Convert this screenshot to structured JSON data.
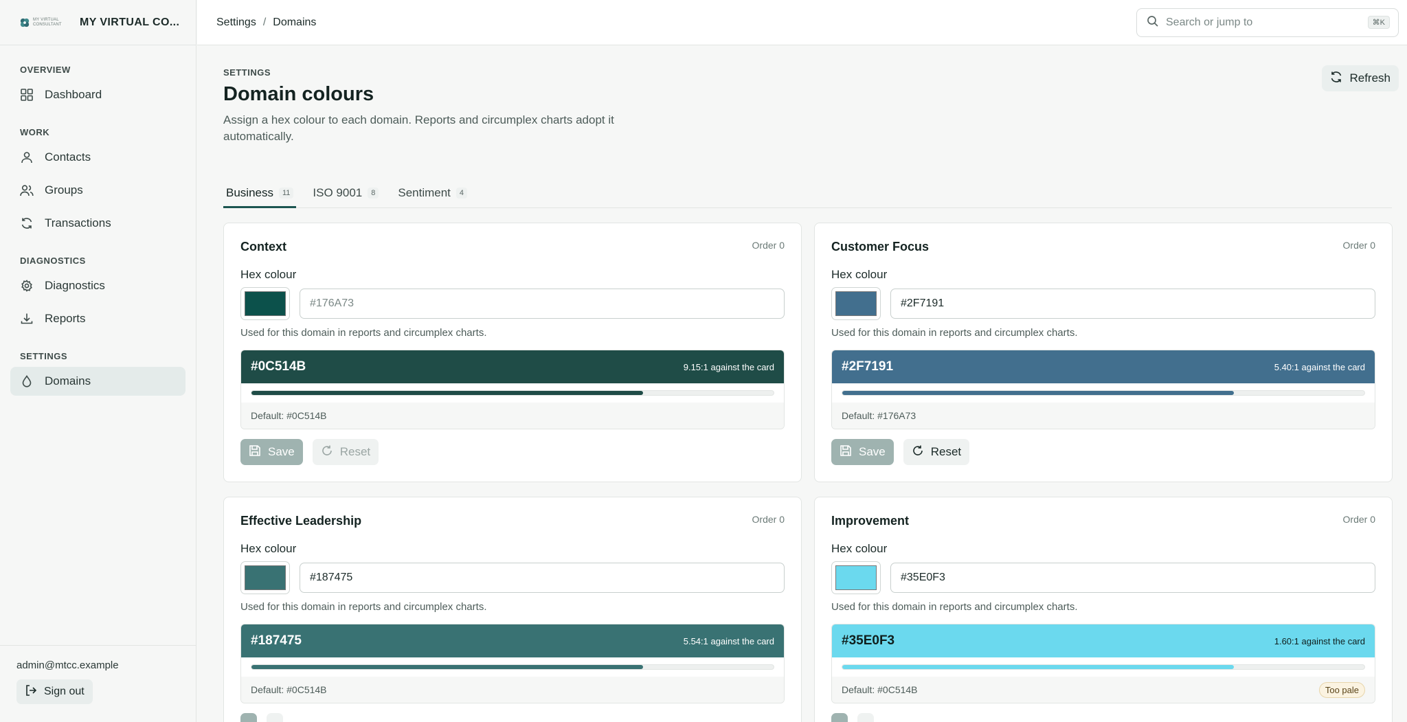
{
  "brand": {
    "small_text": "MY VIRTUAL CONSULTANT",
    "name": "MY VIRTUAL CO..."
  },
  "sidebar": {
    "sections": [
      {
        "title": "OVERVIEW",
        "items": [
          {
            "label": "Dashboard",
            "icon": "grid-icon"
          }
        ]
      },
      {
        "title": "WORK",
        "items": [
          {
            "label": "Contacts",
            "icon": "user-icon"
          },
          {
            "label": "Groups",
            "icon": "users-icon"
          },
          {
            "label": "Transactions",
            "icon": "refresh-icon"
          }
        ]
      },
      {
        "title": "DIAGNOSTICS",
        "items": [
          {
            "label": "Diagnostics",
            "icon": "gear-icon"
          },
          {
            "label": "Reports",
            "icon": "download-icon"
          }
        ]
      },
      {
        "title": "SETTINGS",
        "items": [
          {
            "label": "Domains",
            "icon": "droplet-icon",
            "active": true
          }
        ]
      }
    ],
    "user_email": "admin@mtcc.example",
    "signout_label": "Sign out"
  },
  "topbar": {
    "breadcrumb": [
      "Settings",
      "/",
      "Domains"
    ],
    "search_placeholder": "Search or jump to",
    "search_shortcut": "⌘K"
  },
  "page": {
    "eyebrow": "SETTINGS",
    "title": "Domain colours",
    "description": "Assign a hex colour to each domain. Reports and circumplex charts adopt it automatically.",
    "refresh_label": "Refresh"
  },
  "tabs": [
    {
      "label": "Business",
      "count": "11",
      "active": true
    },
    {
      "label": "ISO 9001",
      "count": "8"
    },
    {
      "label": "Sentiment",
      "count": "4"
    }
  ],
  "cards": [
    {
      "title": "Context",
      "order": "Order 0",
      "hex_label": "Hex colour",
      "input_value": "",
      "input_placeholder": "#176A73",
      "swatch_color": "#0C514B",
      "hint": "Used for this domain in reports and circumplex charts.",
      "preview_hex": "#0C514B",
      "preview_color": "#1F4C47",
      "ratio": "9.15:1 against the card",
      "progress": 0.75,
      "default_text": "Default: #0C514B",
      "badge": "",
      "save_label": "Save",
      "reset_label": "Reset",
      "reset_disabled": true
    },
    {
      "title": "Customer Focus",
      "order": "Order 0",
      "hex_label": "Hex colour",
      "input_value": "#2F7191",
      "input_placeholder": "",
      "swatch_color": "#426F8E",
      "hint": "Used for this domain in reports and circumplex charts.",
      "preview_hex": "#2F7191",
      "preview_color": "#426F8E",
      "ratio": "5.40:1 against the card",
      "progress": 0.75,
      "default_text": "Default: #176A73",
      "badge": "",
      "save_label": "Save",
      "reset_label": "Reset",
      "reset_disabled": false
    },
    {
      "title": "Effective Leadership",
      "order": "Order 0",
      "hex_label": "Hex colour",
      "input_value": "#187475",
      "input_placeholder": "",
      "swatch_color": "#397273",
      "hint": "Used for this domain in reports and circumplex charts.",
      "preview_hex": "#187475",
      "preview_color": "#397273",
      "ratio": "5.54:1 against the card",
      "progress": 0.75,
      "default_text": "Default: #0C514B",
      "badge": "",
      "save_label": "",
      "reset_label": "",
      "reset_disabled": false
    },
    {
      "title": "Improvement",
      "order": "Order 0",
      "hex_label": "Hex colour",
      "input_value": "#35E0F3",
      "input_placeholder": "",
      "swatch_color": "#6BD9EE",
      "hint": "Used for this domain in reports and circumplex charts.",
      "preview_hex": "#35E0F3",
      "preview_color": "#6BD9EE",
      "ratio": "1.60:1 against the card",
      "progress": 0.75,
      "default_text": "Default: #0C514B",
      "badge": "Too pale",
      "save_label": "",
      "reset_label": "",
      "reset_disabled": false
    }
  ]
}
